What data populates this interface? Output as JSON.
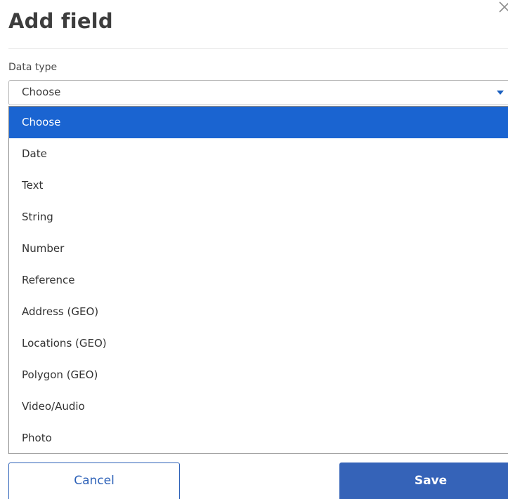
{
  "dialog": {
    "title": "Add field"
  },
  "data_type": {
    "label": "Data type",
    "selected": "Choose",
    "options": [
      "Choose",
      "Date",
      "Text",
      "String",
      "Number",
      "Reference",
      "Address (GEO)",
      "Locations (GEO)",
      "Polygon (GEO)",
      "Video/Audio",
      "Photo"
    ]
  },
  "footer": {
    "cancel_label": "Cancel",
    "save_label": "Save"
  },
  "colors": {
    "accent": "#1a64d1",
    "button_primary": "#3563b8",
    "title_text": "#3d3d3d"
  },
  "icons": {
    "close": "close-icon",
    "caret": "chevron-down-icon"
  }
}
